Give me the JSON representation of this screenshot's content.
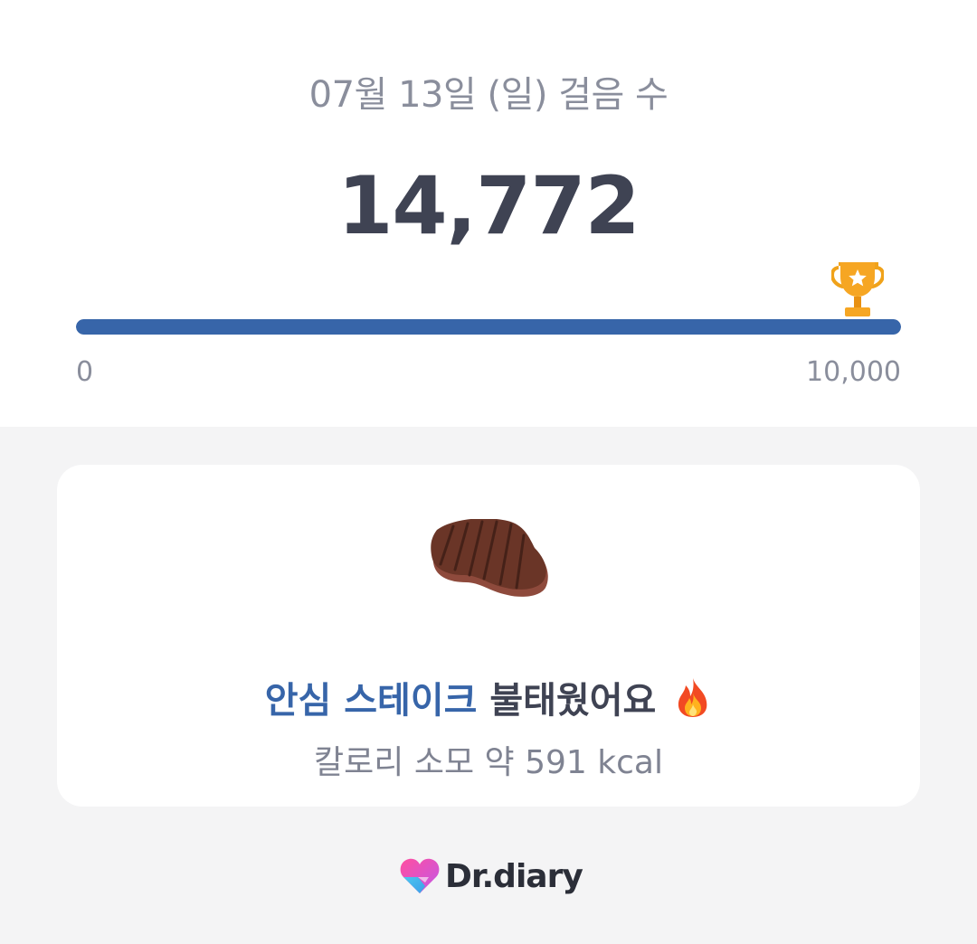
{
  "header": {
    "date_title": "07월 13일 (일) 걸음 수",
    "steps": "14,772"
  },
  "progress": {
    "min_label": "0",
    "max_label": "10,000",
    "fraction": 1.0,
    "bar_color": "#3765a9",
    "goal_icon": "trophy-icon"
  },
  "card": {
    "food_icon": "steak-icon",
    "food_name": "안심 스테이크",
    "burned_text": "불태웠어요",
    "fire_icon": "fire-icon",
    "calorie_text": "칼로리 소모 약 591 kcal"
  },
  "brand": {
    "name": "Dr.diary",
    "logo_icon": "heart-logo-icon"
  }
}
